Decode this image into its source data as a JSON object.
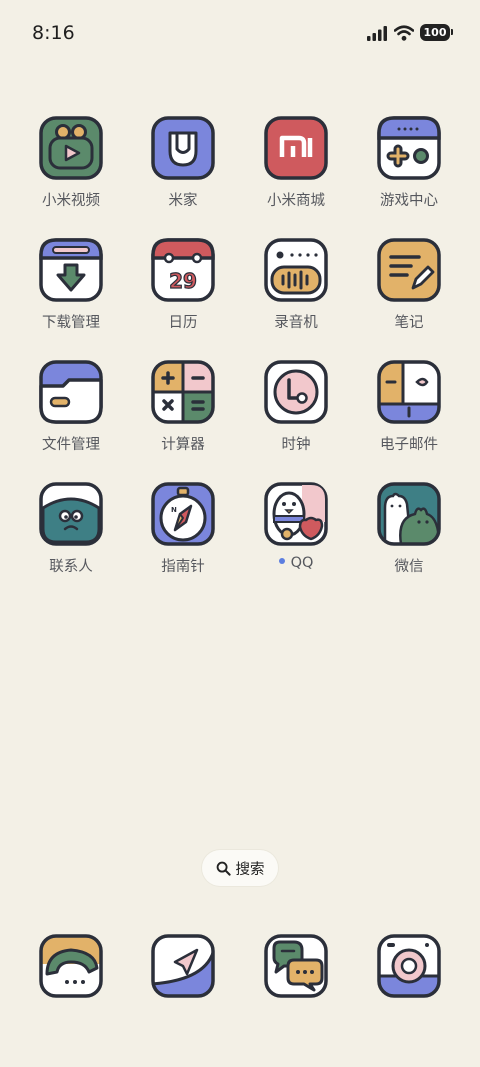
{
  "status_bar": {
    "time": "8:16",
    "battery": "100",
    "icons": [
      "signal-icon",
      "wifi-icon",
      "battery-icon"
    ]
  },
  "apps": {
    "mi_video": {
      "label": "小米视频",
      "icon": "mi-video-icon"
    },
    "mi_home": {
      "label": "米家",
      "icon": "mi-home-icon"
    },
    "mi_store": {
      "label": "小米商城",
      "icon": "mi-store-icon"
    },
    "game_center": {
      "label": "游戏中心",
      "icon": "game-center-icon"
    },
    "downloads": {
      "label": "下载管理",
      "icon": "download-manager-icon"
    },
    "calendar": {
      "label": "日历",
      "icon": "calendar-icon",
      "date_number": "29"
    },
    "recorder": {
      "label": "录音机",
      "icon": "recorder-icon"
    },
    "notes": {
      "label": "笔记",
      "icon": "notes-icon"
    },
    "file_manager": {
      "label": "文件管理",
      "icon": "folder-icon"
    },
    "calculator": {
      "label": "计算器",
      "icon": "calculator-icon"
    },
    "clock": {
      "label": "时钟",
      "icon": "clock-icon"
    },
    "email": {
      "label": "电子邮件",
      "icon": "email-icon"
    },
    "contacts": {
      "label": "联系人",
      "icon": "contacts-icon"
    },
    "compass": {
      "label": "指南针",
      "icon": "compass-icon",
      "north_mark": "N"
    },
    "qq": {
      "label": "QQ",
      "icon": "qq-icon",
      "has_new_dot": true
    },
    "wechat": {
      "label": "微信",
      "icon": "wechat-icon"
    }
  },
  "search": {
    "label": "搜索",
    "icon": "search-icon"
  },
  "dock": [
    "phone-icon",
    "browser-icon",
    "messages-icon",
    "camera-icon"
  ],
  "colors": {
    "background": "#f3f0e6",
    "outline": "#2b2f3a",
    "green": "#5b8a6b",
    "blue": "#7b86dc",
    "red": "#cf5a5e",
    "orange": "#e2b269",
    "teal": "#3e7f85",
    "pink": "#f2c8cc",
    "dot_blue": "#5c7ee0"
  }
}
